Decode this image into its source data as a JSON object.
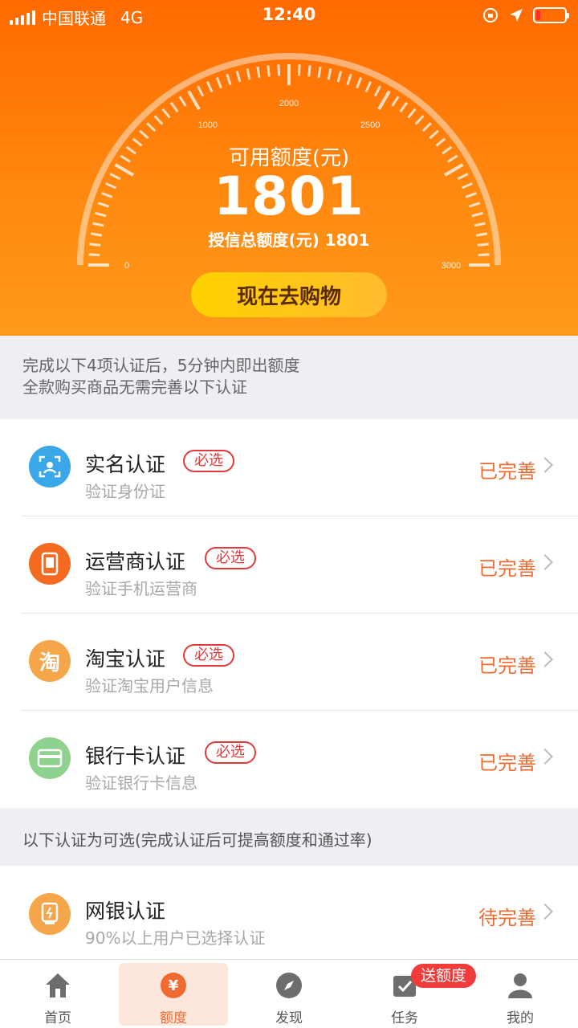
{
  "status_bar": {
    "carrier": "中国联通",
    "network": "4G",
    "time": "12:40"
  },
  "gauge": {
    "available_label": "可用额度(元)",
    "available_value": "1801",
    "total_label": "授信总额度(元) 1801",
    "ticks": [
      "0",
      "1000",
      "2000",
      "2500",
      "3000"
    ]
  },
  "shop_button": "现在去购物",
  "notice": {
    "line1": "完成以下4项认证后，5分钟内即出额度",
    "line2": "全款购买商品无需完善以下认证"
  },
  "required_items": [
    {
      "title": "实名认证",
      "badge": "必选",
      "sub": "验证身份证",
      "status": "已完善",
      "icon": "face-scan-icon",
      "color": "#39a7e8"
    },
    {
      "title": "运营商认证",
      "badge": "必选",
      "sub": "验证手机运营商",
      "status": "已完善",
      "icon": "phone-icon",
      "color": "#f46a20"
    },
    {
      "title": "淘宝认证",
      "badge": "必选",
      "sub": "验证淘宝用户信息",
      "status": "已完善",
      "icon": "taobao-icon",
      "color": "#f5a64a",
      "glyph": "淘"
    },
    {
      "title": "银行卡认证",
      "badge": "必选",
      "sub": "验证银行卡信息",
      "status": "已完善",
      "icon": "bank-card-icon",
      "color": "#8fd28f"
    }
  ],
  "optional_notice": "以下认证为可选(完成认证后可提高额度和通过率)",
  "optional_items": [
    {
      "title": "网银认证",
      "sub": "90%以上用户已选择认证",
      "status": "待完善",
      "icon": "online-bank-icon",
      "color": "#f5a64a"
    }
  ],
  "tabs": [
    {
      "label": "首页",
      "icon": "home-icon"
    },
    {
      "label": "额度",
      "icon": "credit-icon"
    },
    {
      "label": "发现",
      "icon": "compass-icon"
    },
    {
      "label": "任务",
      "icon": "task-icon"
    },
    {
      "label": "我的",
      "icon": "user-icon"
    }
  ],
  "task_badge": "送额度",
  "colors": {
    "brand_orange": "#ff6a00",
    "status_done": "#ef6b32",
    "badge_red": "#e23a3a"
  }
}
